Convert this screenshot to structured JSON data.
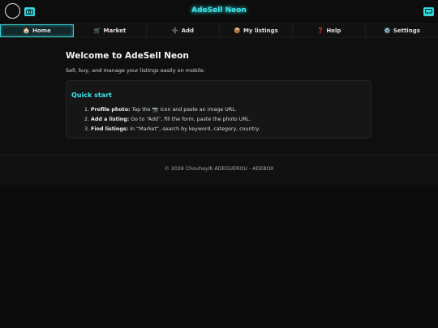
{
  "header": {
    "title": "AdeSell Neon",
    "left_icon": "camera-icon",
    "right_icon": "chat-icon",
    "accent_color": "#3ee6ea"
  },
  "nav": {
    "items": [
      {
        "icon": "🏠",
        "label": "Home",
        "active": true
      },
      {
        "icon": "🛒",
        "label": "Market",
        "active": false
      },
      {
        "icon": "➕",
        "label": "Add",
        "active": false
      },
      {
        "icon": "📦",
        "label": "My listings",
        "active": false
      },
      {
        "icon": "❓",
        "label": "Help",
        "active": false
      },
      {
        "icon": "⚙️",
        "label": "Settings",
        "active": false
      }
    ]
  },
  "main": {
    "heading": "Welcome to AdeSell Neon",
    "subtitle": "Sell, buy, and manage your listings easily on mobile.",
    "quick_start": {
      "title": "Quick start",
      "steps": [
        {
          "num": "1.",
          "bold": "Profile photo:",
          "before": " Tap the ",
          "icon": "📷",
          "after": " icon and paste an image URL."
        },
        {
          "num": "2.",
          "bold": "Add a listing:",
          "text": " Go to “Add”, fill the form, paste the photo URL."
        },
        {
          "num": "3.",
          "bold": "Find listings:",
          "text": " In “Market”, search by keyword, category, country."
        }
      ]
    }
  },
  "footer": {
    "text": "© 2026 Chouhayib ADEGUEROU - ADEBOX"
  }
}
